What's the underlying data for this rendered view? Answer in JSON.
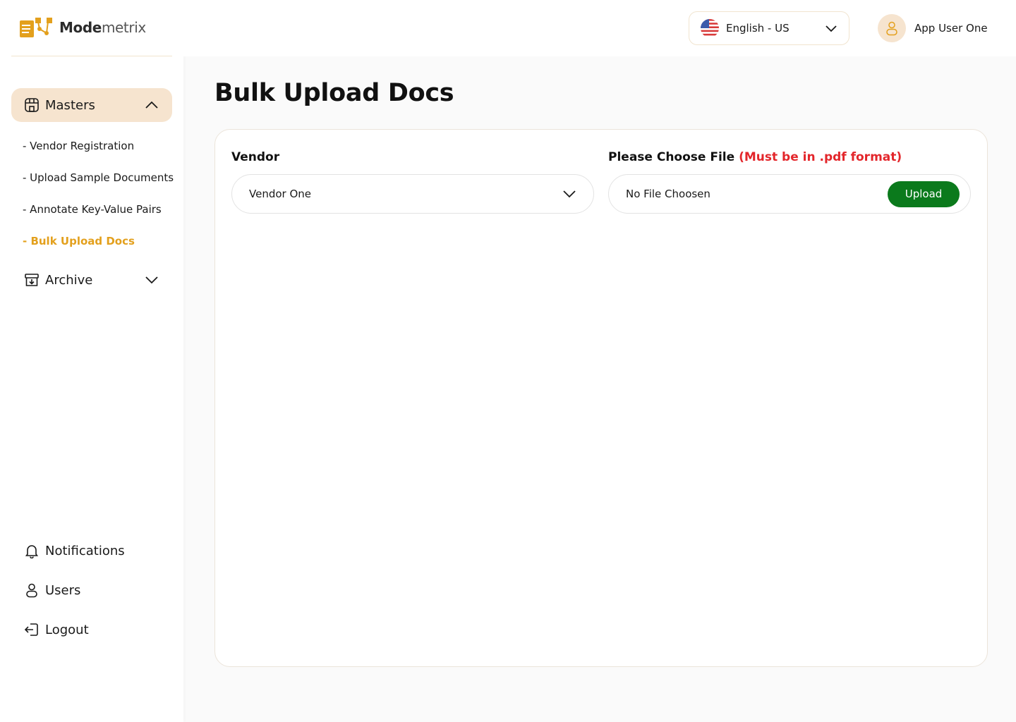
{
  "brand": {
    "name_part1": "Mode",
    "name_part2": "metrix"
  },
  "sidebar": {
    "masters": {
      "label": "Masters",
      "expanded": true
    },
    "sub_items": [
      {
        "label": "- Vendor Registration",
        "active": false
      },
      {
        "label": "- Upload Sample Documents",
        "active": false
      },
      {
        "label": "- Annotate Key-Value Pairs",
        "active": false
      },
      {
        "label": "- Bulk Upload Docs",
        "active": true
      }
    ],
    "archive": {
      "label": "Archive",
      "expanded": false
    },
    "bottom": {
      "notifications": "Notifications",
      "users": "Users",
      "logout": "Logout"
    }
  },
  "header": {
    "language": "English - US",
    "user_name": "App User One"
  },
  "main": {
    "title": "Bulk Upload Docs",
    "vendor_label": "Vendor",
    "vendor_value": "Vendor One",
    "file_label": "Please Choose File",
    "file_warning": "(Must be in .pdf format)",
    "file_status": "No File Choosen",
    "upload_label": "Upload"
  },
  "colors": {
    "accent": "#e3a01d",
    "accent_bg": "#f6e4cf",
    "upload_button": "#0b7a1c",
    "warning": "#e3262b"
  }
}
